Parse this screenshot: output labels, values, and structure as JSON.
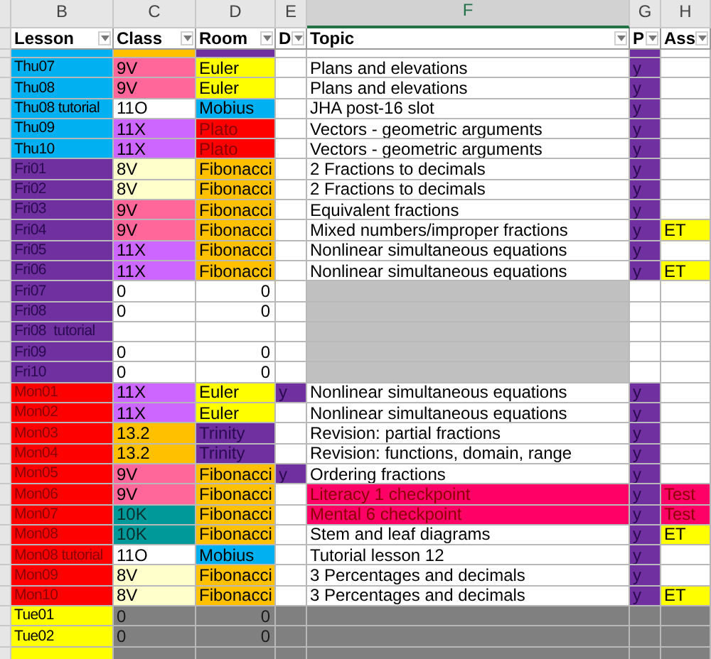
{
  "column_letters": [
    {
      "letter": "B",
      "selected": false
    },
    {
      "letter": "C",
      "selected": false
    },
    {
      "letter": "D",
      "selected": false
    },
    {
      "letter": "E",
      "selected": false
    },
    {
      "letter": "F",
      "selected": true
    },
    {
      "letter": "G",
      "selected": false
    },
    {
      "letter": "H",
      "selected": false
    }
  ],
  "headers": [
    "Lesson",
    "Class",
    "Room",
    "D",
    "Topic",
    "P",
    "Ass"
  ],
  "rows": [
    {
      "kind": "cut_top",
      "cells": [
        {
          "color": "#00b0f0"
        },
        {
          "color": "#ffc000"
        },
        {
          "color": "#7030a0"
        },
        {
          "color": "#ffffff"
        },
        {
          "color": "#ffffff"
        },
        {
          "color": "#7030a0"
        },
        {
          "color": "#ffffff"
        }
      ]
    },
    {
      "kind": "lesson",
      "cells": [
        {
          "text": "Thu07",
          "color": "#00b0f0"
        },
        {
          "text": "9V",
          "color": "#ff6699"
        },
        {
          "text": "Euler",
          "color": "#ffff00"
        },
        {
          "color": "#ffffff"
        },
        {
          "text": "Plans and elevations",
          "color": "#ffffff"
        },
        {
          "text": "y",
          "color": "#7030a0"
        },
        {
          "color": "#ffffff"
        }
      ]
    },
    {
      "kind": "lesson",
      "cells": [
        {
          "text": "Thu08",
          "color": "#00b0f0"
        },
        {
          "text": "9V",
          "color": "#ff6699"
        },
        {
          "text": "Euler",
          "color": "#ffff00"
        },
        {
          "color": "#ffffff"
        },
        {
          "text": "Plans and elevations",
          "color": "#ffffff"
        },
        {
          "text": "y",
          "color": "#7030a0"
        },
        {
          "color": "#ffffff"
        }
      ]
    },
    {
      "kind": "lesson",
      "cells": [
        {
          "text": "Thu08 tutorial",
          "color": "#00b0f0"
        },
        {
          "text": "11O",
          "color": "#ffffff"
        },
        {
          "text": "Mobius",
          "color": "#00b0f0"
        },
        {
          "color": "#ffffff"
        },
        {
          "text": "JHA post-16 slot",
          "color": "#ffffff"
        },
        {
          "text": "y",
          "color": "#7030a0"
        },
        {
          "color": "#ffffff"
        }
      ]
    },
    {
      "kind": "lesson",
      "cells": [
        {
          "text": "Thu09",
          "color": "#00b0f0"
        },
        {
          "text": "11X",
          "color": "#cc66ff"
        },
        {
          "text": "Plato",
          "color": "#ff0000"
        },
        {
          "color": "#ffffff"
        },
        {
          "text": "Vectors - geometric arguments",
          "color": "#ffffff"
        },
        {
          "text": "y",
          "color": "#7030a0"
        },
        {
          "color": "#ffffff"
        }
      ]
    },
    {
      "kind": "lesson",
      "cells": [
        {
          "text": "Thu10",
          "color": "#00b0f0"
        },
        {
          "text": "11X",
          "color": "#cc66ff"
        },
        {
          "text": "Plato",
          "color": "#ff0000"
        },
        {
          "color": "#ffffff"
        },
        {
          "text": "Vectors - geometric arguments",
          "color": "#ffffff"
        },
        {
          "text": "y",
          "color": "#7030a0"
        },
        {
          "color": "#ffffff"
        }
      ]
    },
    {
      "kind": "lesson",
      "cells": [
        {
          "text": "Fri01",
          "color": "#7030a0"
        },
        {
          "text": "8V",
          "color": "#ffffcc"
        },
        {
          "text": "Fibonacci",
          "color": "#ffc000"
        },
        {
          "color": "#ffffff"
        },
        {
          "text": "2 Fractions to decimals",
          "color": "#ffffff"
        },
        {
          "text": "y",
          "color": "#7030a0"
        },
        {
          "color": "#ffffff"
        }
      ]
    },
    {
      "kind": "lesson",
      "cells": [
        {
          "text": "Fri02",
          "color": "#7030a0"
        },
        {
          "text": "8V",
          "color": "#ffffcc"
        },
        {
          "text": "Fibonacci",
          "color": "#ffc000"
        },
        {
          "color": "#ffffff"
        },
        {
          "text": "2 Fractions to decimals",
          "color": "#ffffff"
        },
        {
          "text": "y",
          "color": "#7030a0"
        },
        {
          "color": "#ffffff"
        }
      ]
    },
    {
      "kind": "lesson",
      "cells": [
        {
          "text": "Fri03",
          "color": "#7030a0"
        },
        {
          "text": "9V",
          "color": "#ff6699"
        },
        {
          "text": "Fibonacci",
          "color": "#ffc000"
        },
        {
          "color": "#ffffff"
        },
        {
          "text": "Equivalent fractions",
          "color": "#ffffff"
        },
        {
          "text": "y",
          "color": "#7030a0"
        },
        {
          "color": "#ffffff"
        }
      ]
    },
    {
      "kind": "lesson",
      "cells": [
        {
          "text": "Fri04",
          "color": "#7030a0"
        },
        {
          "text": "9V",
          "color": "#ff6699"
        },
        {
          "text": "Fibonacci",
          "color": "#ffc000"
        },
        {
          "color": "#ffffff"
        },
        {
          "text": "Mixed numbers/improper fractions",
          "color": "#ffffff"
        },
        {
          "text": "y",
          "color": "#7030a0"
        },
        {
          "text": "ET",
          "color": "#ffff00"
        }
      ]
    },
    {
      "kind": "lesson",
      "cells": [
        {
          "text": "Fri05",
          "color": "#7030a0"
        },
        {
          "text": "11X",
          "color": "#cc66ff"
        },
        {
          "text": "Fibonacci",
          "color": "#ffc000"
        },
        {
          "color": "#ffffff"
        },
        {
          "text": "Nonlinear simultaneous equations",
          "color": "#ffffff"
        },
        {
          "text": "y",
          "color": "#7030a0"
        },
        {
          "color": "#ffffff"
        }
      ]
    },
    {
      "kind": "lesson",
      "cells": [
        {
          "text": "Fri06",
          "color": "#7030a0"
        },
        {
          "text": "11X",
          "color": "#cc66ff"
        },
        {
          "text": "Fibonacci",
          "color": "#ffc000"
        },
        {
          "color": "#ffffff"
        },
        {
          "text": "Nonlinear simultaneous equations",
          "color": "#ffffff"
        },
        {
          "text": "y",
          "color": "#7030a0"
        },
        {
          "text": "ET",
          "color": "#ffff00"
        }
      ]
    },
    {
      "kind": "zero",
      "cells": [
        {
          "text": "Fri07",
          "color": "#7030a0"
        },
        {
          "text": "0",
          "color": "#ffffff"
        },
        {
          "text": "0",
          "color": "#ffffff"
        },
        {
          "color": "#ffffff"
        },
        {
          "color": "#c0c0c0"
        },
        {
          "color": "#ffffff"
        },
        {
          "color": "#ffffff"
        }
      ]
    },
    {
      "kind": "zero",
      "cells": [
        {
          "text": "Fri08",
          "color": "#7030a0"
        },
        {
          "text": "0",
          "color": "#ffffff"
        },
        {
          "text": "0",
          "color": "#ffffff"
        },
        {
          "color": "#ffffff"
        },
        {
          "color": "#c0c0c0"
        },
        {
          "color": "#ffffff"
        },
        {
          "color": "#ffffff"
        }
      ]
    },
    {
      "kind": "zero",
      "cells": [
        {
          "text": "Fri08  tutorial",
          "color": "#7030a0"
        },
        {
          "color": "#ffffff"
        },
        {
          "color": "#ffffff"
        },
        {
          "color": "#ffffff"
        },
        {
          "color": "#c0c0c0"
        },
        {
          "color": "#ffffff"
        },
        {
          "color": "#ffffff"
        }
      ]
    },
    {
      "kind": "zero",
      "cells": [
        {
          "text": "Fri09",
          "color": "#7030a0"
        },
        {
          "text": "0",
          "color": "#ffffff"
        },
        {
          "text": "0",
          "color": "#ffffff"
        },
        {
          "color": "#ffffff"
        },
        {
          "color": "#c0c0c0"
        },
        {
          "color": "#ffffff"
        },
        {
          "color": "#ffffff"
        }
      ]
    },
    {
      "kind": "zero",
      "cells": [
        {
          "text": "Fri10",
          "color": "#7030a0"
        },
        {
          "text": "0",
          "color": "#ffffff"
        },
        {
          "text": "0",
          "color": "#ffffff"
        },
        {
          "color": "#ffffff"
        },
        {
          "color": "#c0c0c0"
        },
        {
          "color": "#ffffff"
        },
        {
          "color": "#ffffff"
        }
      ]
    },
    {
      "kind": "lesson",
      "cells": [
        {
          "text": "Mon01",
          "color": "#ff0000"
        },
        {
          "text": "11X",
          "color": "#cc66ff"
        },
        {
          "text": "Euler",
          "color": "#ffff00"
        },
        {
          "text": "y",
          "color": "#7030a0"
        },
        {
          "text": "Nonlinear simultaneous equations",
          "color": "#ffffff"
        },
        {
          "text": "y",
          "color": "#7030a0"
        },
        {
          "color": "#ffffff"
        }
      ]
    },
    {
      "kind": "lesson",
      "cells": [
        {
          "text": "Mon02",
          "color": "#ff0000"
        },
        {
          "text": "11X",
          "color": "#cc66ff"
        },
        {
          "text": "Euler",
          "color": "#ffff00"
        },
        {
          "color": "#ffffff"
        },
        {
          "text": "Nonlinear simultaneous equations",
          "color": "#ffffff"
        },
        {
          "text": "y",
          "color": "#7030a0"
        },
        {
          "color": "#ffffff"
        }
      ]
    },
    {
      "kind": "lesson",
      "cells": [
        {
          "text": "Mon03",
          "color": "#ff0000"
        },
        {
          "text": "13.2",
          "color": "#ffc000"
        },
        {
          "text": "Trinity",
          "color": "#7030a0"
        },
        {
          "color": "#ffffff"
        },
        {
          "text": "Revision: partial fractions",
          "color": "#ffffff"
        },
        {
          "text": "y",
          "color": "#7030a0"
        },
        {
          "color": "#ffffff"
        }
      ]
    },
    {
      "kind": "lesson",
      "cells": [
        {
          "text": "Mon04",
          "color": "#ff0000"
        },
        {
          "text": "13.2",
          "color": "#ffc000"
        },
        {
          "text": "Trinity",
          "color": "#7030a0"
        },
        {
          "color": "#ffffff"
        },
        {
          "text": "Revision: functions, domain, range",
          "color": "#ffffff"
        },
        {
          "text": "y",
          "color": "#7030a0"
        },
        {
          "color": "#ffffff"
        }
      ]
    },
    {
      "kind": "lesson",
      "cells": [
        {
          "text": "Mon05",
          "color": "#ff0000"
        },
        {
          "text": "9V",
          "color": "#ff6699"
        },
        {
          "text": "Fibonacci",
          "color": "#ffc000"
        },
        {
          "text": "y",
          "color": "#7030a0"
        },
        {
          "text": "Ordering fractions",
          "color": "#ffffff"
        },
        {
          "text": "y",
          "color": "#7030a0"
        },
        {
          "color": "#ffffff"
        }
      ]
    },
    {
      "kind": "lesson",
      "cells": [
        {
          "text": "Mon06",
          "color": "#ff0000"
        },
        {
          "text": "9V",
          "color": "#ff6699"
        },
        {
          "text": "Fibonacci",
          "color": "#ffc000"
        },
        {
          "color": "#ffffff"
        },
        {
          "text": "Literacy 1 checkpoint",
          "color": "#ff0066"
        },
        {
          "text": "y",
          "color": "#7030a0"
        },
        {
          "text": "Test",
          "color": "#ff0066"
        }
      ]
    },
    {
      "kind": "lesson",
      "cells": [
        {
          "text": "Mon07",
          "color": "#ff0000"
        },
        {
          "text": "10K",
          "color": "#009999"
        },
        {
          "text": "Fibonacci",
          "color": "#ffc000"
        },
        {
          "color": "#ffffff"
        },
        {
          "text": "Mental 6 checkpoint",
          "color": "#ff0066"
        },
        {
          "text": "y",
          "color": "#7030a0"
        },
        {
          "text": "Test",
          "color": "#ff0066"
        }
      ]
    },
    {
      "kind": "lesson",
      "cells": [
        {
          "text": "Mon08",
          "color": "#ff0000"
        },
        {
          "text": "10K",
          "color": "#009999"
        },
        {
          "text": "Fibonacci",
          "color": "#ffc000"
        },
        {
          "color": "#ffffff"
        },
        {
          "text": "Stem and leaf diagrams",
          "color": "#ffffff"
        },
        {
          "text": "y",
          "color": "#7030a0"
        },
        {
          "text": "ET",
          "color": "#ffff00"
        }
      ]
    },
    {
      "kind": "lesson",
      "cells": [
        {
          "text": "Mon08 tutorial",
          "color": "#ff0000"
        },
        {
          "text": "11O",
          "color": "#ffffff"
        },
        {
          "text": "Mobius",
          "color": "#00b0f0"
        },
        {
          "color": "#ffffff"
        },
        {
          "text": "Tutorial lesson 12",
          "color": "#ffffff"
        },
        {
          "text": "y",
          "color": "#7030a0"
        },
        {
          "color": "#ffffff"
        }
      ]
    },
    {
      "kind": "lesson",
      "cells": [
        {
          "text": "Mon09",
          "color": "#ff0000"
        },
        {
          "text": "8V",
          "color": "#ffffcc"
        },
        {
          "text": "Fibonacci",
          "color": "#ffc000"
        },
        {
          "color": "#ffffff"
        },
        {
          "text": "3 Percentages and decimals",
          "color": "#ffffff"
        },
        {
          "text": "y",
          "color": "#7030a0"
        },
        {
          "color": "#ffffff"
        }
      ]
    },
    {
      "kind": "lesson",
      "cells": [
        {
          "text": "Mon10",
          "color": "#ff0000"
        },
        {
          "text": "8V",
          "color": "#ffffcc"
        },
        {
          "text": "Fibonacci",
          "color": "#ffc000"
        },
        {
          "color": "#ffffff"
        },
        {
          "text": "3 Percentages and decimals",
          "color": "#ffffff"
        },
        {
          "text": "y",
          "color": "#7030a0"
        },
        {
          "text": "ET",
          "color": "#ffff00"
        }
      ]
    },
    {
      "kind": "zero",
      "cells": [
        {
          "text": "Tue01",
          "color": "#ffff00"
        },
        {
          "text": "0",
          "color": "#808080"
        },
        {
          "text": "0",
          "color": "#808080"
        },
        {
          "color": "#808080"
        },
        {
          "color": "#808080"
        },
        {
          "color": "#808080"
        },
        {
          "color": "#808080"
        }
      ]
    },
    {
      "kind": "zero",
      "cells": [
        {
          "text": "Tue02",
          "color": "#ffff00"
        },
        {
          "text": "0",
          "color": "#808080"
        },
        {
          "text": "0",
          "color": "#808080"
        },
        {
          "color": "#808080"
        },
        {
          "color": "#808080"
        },
        {
          "color": "#808080"
        },
        {
          "color": "#808080"
        }
      ]
    },
    {
      "kind": "cut_bottom",
      "cells": [
        {
          "color": "#ffff00"
        },
        {
          "color": "#808080"
        },
        {
          "color": "#808080"
        },
        {
          "color": "#808080"
        },
        {
          "color": "#808080"
        },
        {
          "color": "#808080"
        },
        {
          "color": "#808080"
        }
      ]
    }
  ]
}
